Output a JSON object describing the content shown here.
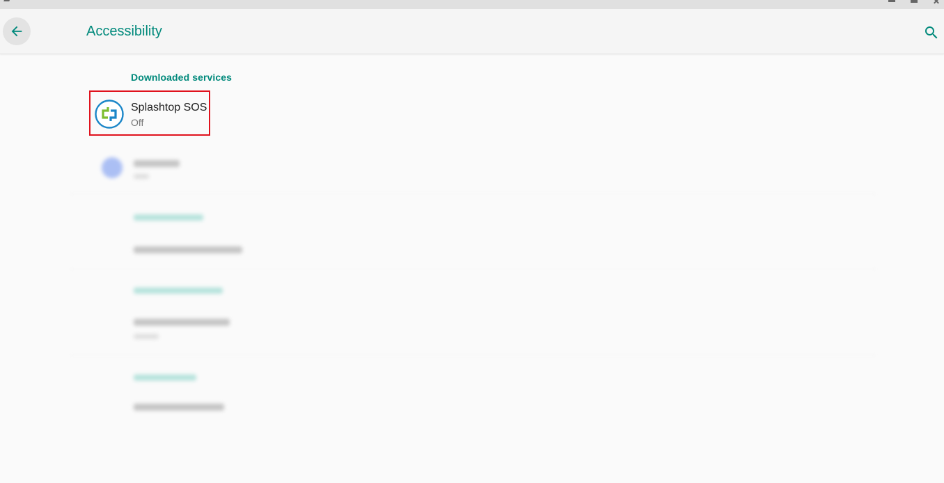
{
  "appbar": {
    "title": "Accessibility"
  },
  "icons": {
    "back": "arrow-back-icon",
    "search": "search-icon",
    "service": "splashtop-sos-logo"
  },
  "colors": {
    "accent": "#00897b",
    "highlight_border": "#e0121d"
  },
  "sections": {
    "downloaded_services": {
      "header": "Downloaded services",
      "items": [
        {
          "title": "Splashtop SOS",
          "summary": "Off"
        }
      ]
    }
  }
}
